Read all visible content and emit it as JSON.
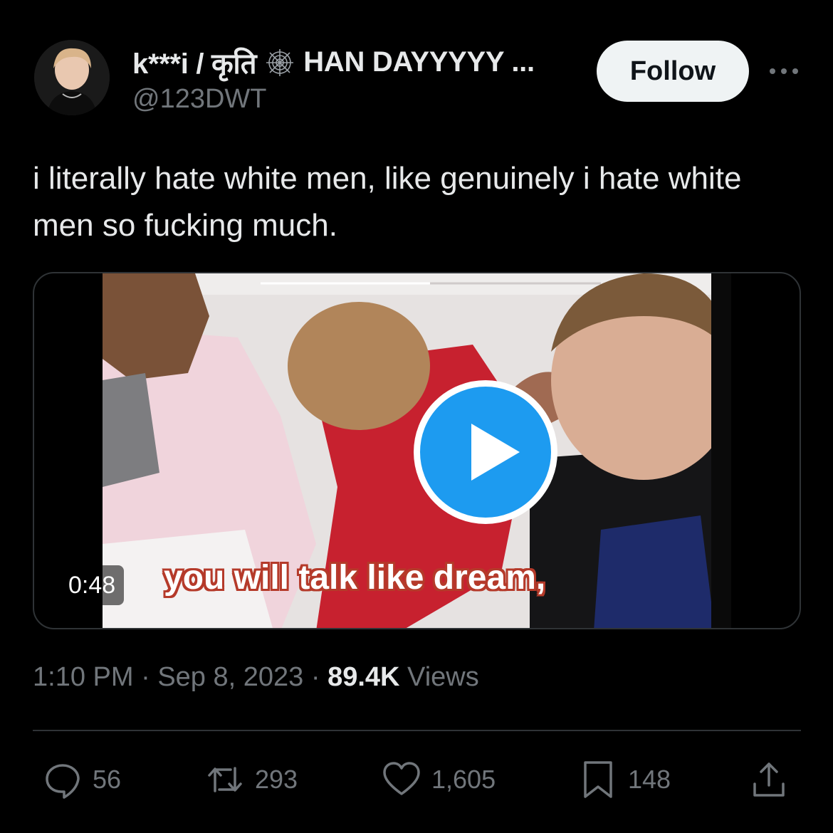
{
  "author": {
    "display_name_prefix": "k***i / कृति",
    "display_name_suffix": "HAN DAYYYYY ...",
    "handle": "@123DWT",
    "avatar_icon": "avatar-photo"
  },
  "follow_label": "Follow",
  "more_icon": "more-icon",
  "tweet": {
    "text": "i literally hate white men, like genuinely i hate white men so fucking much."
  },
  "media": {
    "duration": "0:48",
    "caption": "you will talk like dream,",
    "play_icon": "play-icon",
    "play_color": "#1d9bf0"
  },
  "meta": {
    "time": "1:10 PM",
    "date": "Sep 8, 2023",
    "views_count": "89.4K",
    "views_label": "Views"
  },
  "actions": {
    "replies": "56",
    "retweets": "293",
    "likes": "1,605",
    "bookmarks": "148"
  }
}
